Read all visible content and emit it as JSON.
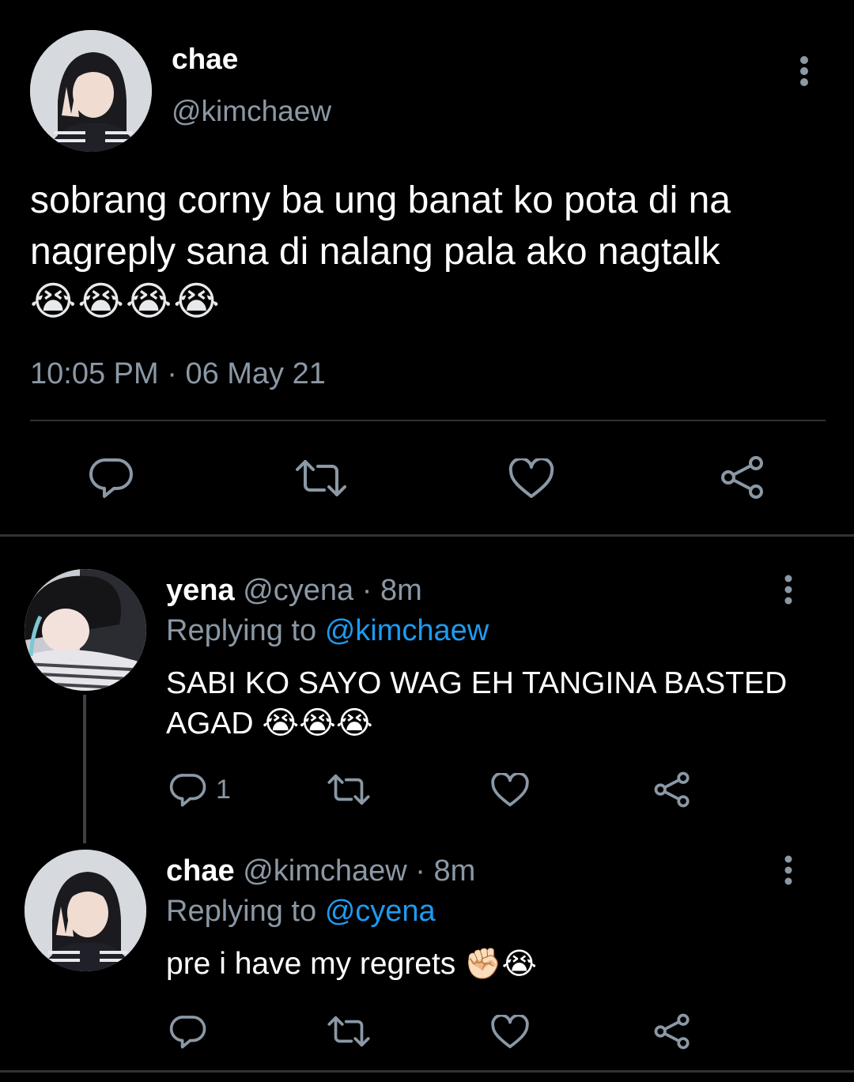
{
  "main_tweet": {
    "author_name": "chae",
    "author_handle": "@kimchaew",
    "text_line1": "sobrang corny ba ung banat ko pota di na",
    "text_line2": "nagreply sana di nalang pala ako nagtalk",
    "emojis": "😭😭😭😭",
    "time": "10:05 PM",
    "separator": "·",
    "date": "06 May 21",
    "icons": [
      "reply-icon",
      "retweet-icon",
      "like-icon",
      "share-icon"
    ]
  },
  "replies": [
    {
      "author_name": "yena",
      "author_handle": "@cyena",
      "meta": "· 8m",
      "replying_label": "Replying to",
      "replying_to": "@kimchaew",
      "text_line1": "SABI KO SAYO WAG EH TANGINA BASTED",
      "text_line2": "AGAD",
      "emojis": "😭😭😭",
      "reply_count": "1"
    },
    {
      "author_name": "chae",
      "author_handle": "@kimchaew",
      "meta": "· 8m",
      "replying_label": "Replying to",
      "replying_to": "@cyena",
      "text_line1": "pre i have my regrets",
      "emojis": "✊🏻😭",
      "reply_count": ""
    }
  ],
  "colors": {
    "background": "#000000",
    "text": "#e7e9ea",
    "muted": "#8b98a5",
    "link": "#1d9bf0",
    "divider": "#2f3336"
  }
}
